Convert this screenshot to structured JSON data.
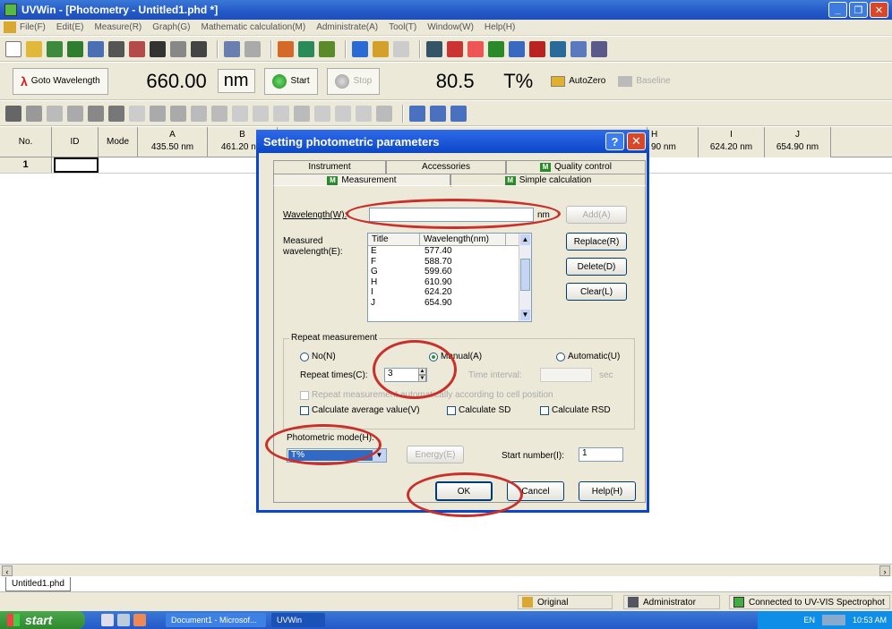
{
  "window": {
    "title": "UVWin - [Photometry - Untitled1.phd *]"
  },
  "menu": [
    "File(F)",
    "Edit(E)",
    "Measure(R)",
    "Graph(G)",
    "Mathematic calculation(M)",
    "Administrate(A)",
    "Tool(T)",
    "Window(W)",
    "Help(H)"
  ],
  "measure_bar": {
    "goto_label": "Goto Wavelength",
    "wavelength": "660.00",
    "wavelength_unit": "nm",
    "start_label": "Start",
    "stop_label": "Stop",
    "reading": "80.5",
    "reading_unit": "T%",
    "autozero_label": "AutoZero",
    "baseline_label": "Baseline"
  },
  "grid": {
    "col_no": "No.",
    "col_id": "ID",
    "col_mode": "Mode",
    "columns": [
      {
        "letter": "A",
        "wl": "435.50 nm"
      },
      {
        "letter": "B",
        "wl": "461.20 nm"
      },
      {
        "letter": "H",
        "wl": "610.90 nm"
      },
      {
        "letter": "I",
        "wl": "624.20 nm"
      },
      {
        "letter": "J",
        "wl": "654.90 nm"
      }
    ],
    "row1_no": "1"
  },
  "doc_tab": "Untitled1.phd",
  "status": {
    "original": "Original",
    "administrator": "Administrator",
    "connection": "Connected to UV-VIS Spectrophot"
  },
  "taskbar": {
    "start": "start",
    "tasks": [
      "Document1 - Microsof...",
      "UVWin"
    ],
    "lang": "EN",
    "clock": "10:53 AM"
  },
  "dialog": {
    "title": "Setting photometric parameters",
    "tabs_back": [
      "Instrument",
      "Accessories",
      "Quality control"
    ],
    "tabs_front": [
      "Measurement",
      "Simple calculation"
    ],
    "wavelength_label": "Wavelength(W):",
    "wavelength_value": "",
    "wavelength_unit": "nm",
    "add_button": "Add(A)",
    "measured_label": "Measured wavelength(E):",
    "list_headers": [
      "Title",
      "Wavelength(nm)"
    ],
    "list_rows": [
      {
        "title": "E",
        "wl": "577.40"
      },
      {
        "title": "F",
        "wl": "588.70"
      },
      {
        "title": "G",
        "wl": "599.60"
      },
      {
        "title": "H",
        "wl": "610.90"
      },
      {
        "title": "I",
        "wl": "624.20"
      },
      {
        "title": "J",
        "wl": "654.90"
      }
    ],
    "replace_button": "Replace(R)",
    "delete_button": "Delete(D)",
    "clear_button": "Clear(L)",
    "repeat_group_title": "Repeat measurement",
    "radio_no": "No(N)",
    "radio_manual": "Manual(A)",
    "radio_automatic": "Automatic(U)",
    "repeat_times_label": "Repeat times(C):",
    "repeat_times_value": "3",
    "time_interval_label": "Time interval:",
    "time_interval_unit": "sec",
    "chk_repeat_auto": "Repeat measurement automatically according to cell position",
    "chk_avg": "Calculate average value(V)",
    "chk_sd": "Calculate SD",
    "chk_rsd": "Calculate RSD",
    "photometric_mode_label": "Photometric mode(H):",
    "photometric_mode_value": "T%",
    "energy_button": "Energy(E)",
    "start_number_label": "Start number(I):",
    "start_number_value": "1",
    "ok_button": "OK",
    "cancel_button": "Cancel",
    "help_button": "Help(H)"
  },
  "colors": {
    "annotation_ring": "#c8302b",
    "xp_blue": "#0a46c9"
  }
}
